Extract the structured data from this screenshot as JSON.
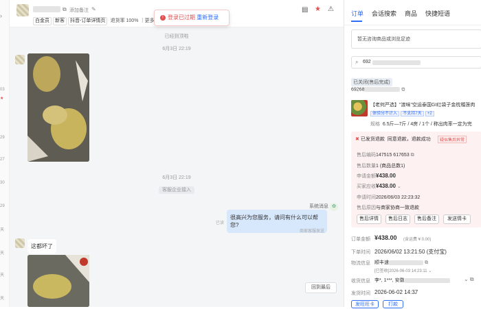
{
  "header": {
    "add_note": "添加备注",
    "tags": [
      "白金员",
      "新客",
      "抖音-订单详情页"
    ],
    "refund_rate": "退货率 100%",
    "more": "更多"
  },
  "toast": {
    "message": "登录已过期",
    "action": "重新登录"
  },
  "chat": {
    "ended_1": "已经到顶啦",
    "date_1": "6月3日 22:19",
    "date_2": "6月3日 22:19",
    "agent_joined": "客服企业接入",
    "system_label": "系统消息",
    "greeting": "很高兴为您服务，请问有什么可以帮您?",
    "read": "已读",
    "sent_by": "商家客服发送",
    "customer_msg": "这都坏了",
    "back_latest": "回到最后"
  },
  "side_dates": [
    "03",
    "29",
    "27",
    "30",
    "29",
    "29",
    "天",
    "天",
    "天",
    "天"
  ],
  "tabs": [
    "订单",
    "会话搜索",
    "商品",
    "快捷短语"
  ],
  "product_notice": "暂无咨询商品或浏览足迹",
  "search_prefix": "692",
  "order": {
    "status": "已关闭(售后完成)",
    "order_no_prefix": "69268",
    "product_title": "【老何严选】\"渡味\"空运泰国GI红袋子金枕榴莲肉",
    "badge_1": "体验分不计入",
    "badge_2": "不支持7天",
    "badge_more": "+2",
    "spec_label": "规格",
    "spec": "6.5斤—7斤 / 4房 / 1个 / 称出肉率一定为完"
  },
  "after_sale": {
    "title": "已发货退款",
    "subtitle": "同意退款，退款成功",
    "alert": "疑似售后异常",
    "rows": [
      {
        "k": "售后编码",
        "v": "147515          617653"
      },
      {
        "k": "售后数量",
        "v": "1 (商品总数1)"
      },
      {
        "k": "申请金额",
        "v": "¥438.00"
      },
      {
        "k": "买家应收",
        "v": "¥438.00"
      },
      {
        "k": "申请时间",
        "v": "2026/06/03 22:23:32"
      },
      {
        "k": "售后原因",
        "v": "与商家协商一致退款"
      }
    ],
    "buttons": [
      "售后详情",
      "售后日志",
      "售后备注",
      "发送情卡"
    ]
  },
  "details": {
    "amount_label": "订单金额",
    "amount": "¥438.00",
    "amount_note": "(含运费 ¥ 0.00)",
    "paid_label": "下单时间",
    "paid": "2026/06/02 13:21:50 (支付宝)",
    "logistics_label": "物流信息",
    "logistics": "顺丰速",
    "logistics_time": "[已签收]2026-06-03 14:23:11",
    "recipient_label": "收货信息",
    "recipient": "李*, 1***, 安徽",
    "ship_label": "发货时间",
    "ship": "2026-06-02 14:37",
    "buttons": [
      "发旺旺卡",
      "打款"
    ]
  },
  "colors": {
    "accent": "#2f6df6",
    "danger": "#e34d4d"
  }
}
